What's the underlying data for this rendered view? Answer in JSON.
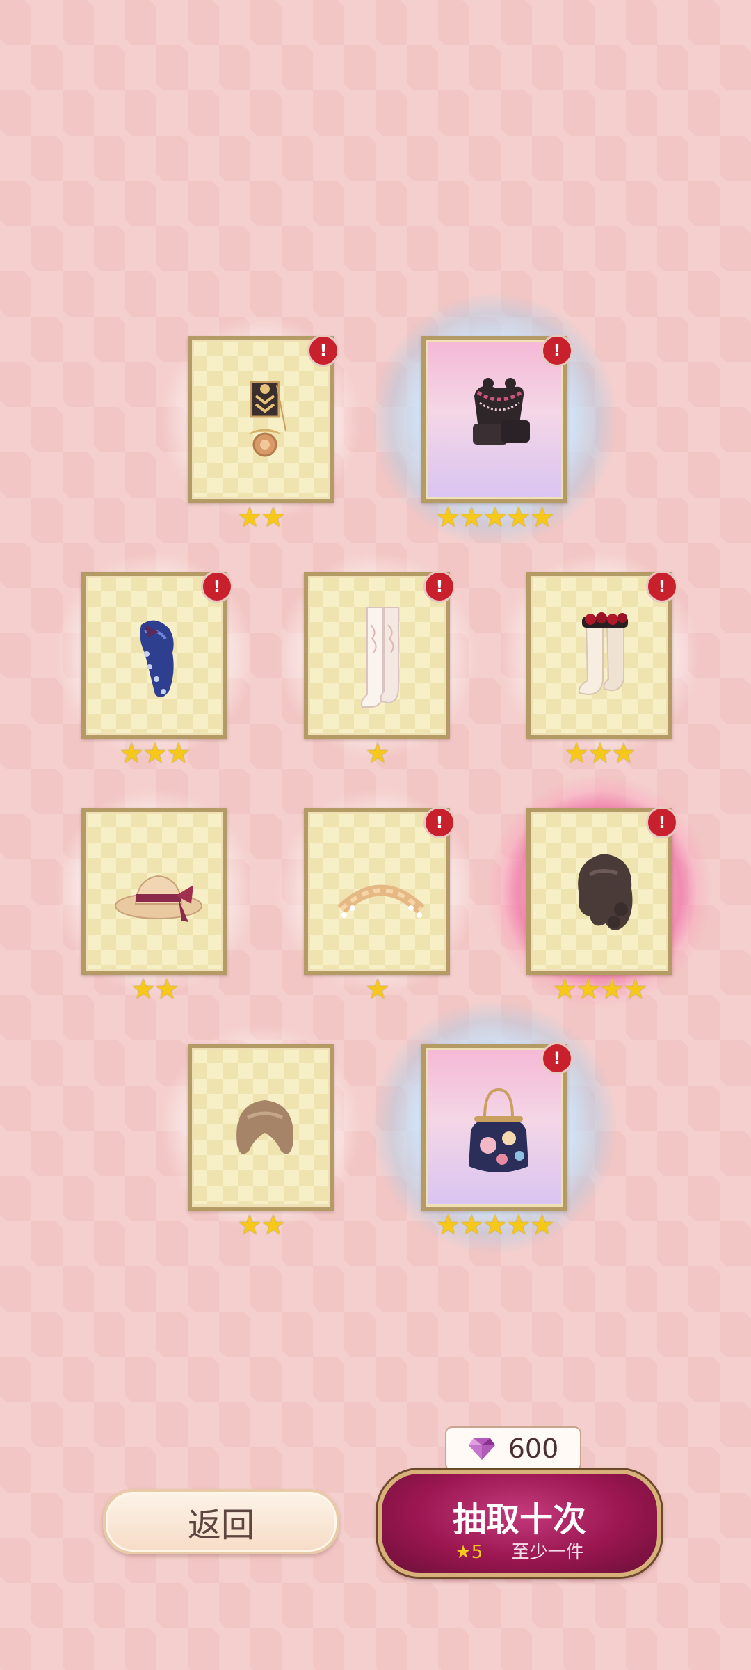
{
  "badge_text": "!",
  "items": [
    {
      "name": "medal-brooch",
      "stars": "★★",
      "rarity": 2,
      "badge": true
    },
    {
      "name": "black-platform-shoes",
      "stars": "★★★★★",
      "rarity": 5,
      "badge": true
    },
    {
      "name": "blue-lace-hair-ornament",
      "stars": "★★★",
      "rarity": 3,
      "badge": true
    },
    {
      "name": "white-lace-stockings",
      "stars": "★",
      "rarity": 1,
      "badge": true
    },
    {
      "name": "rose-frill-socks",
      "stars": "★★★",
      "rarity": 3,
      "badge": true
    },
    {
      "name": "straw-hat-plaid-bow",
      "stars": "★★",
      "rarity": 2,
      "badge": false
    },
    {
      "name": "braided-pearl-headband",
      "stars": "★",
      "rarity": 1,
      "badge": true
    },
    {
      "name": "dark-curly-wig",
      "stars": "★★★★",
      "rarity": 4,
      "badge": true
    },
    {
      "name": "brown-bob-wig",
      "stars": "★★",
      "rarity": 2,
      "badge": false
    },
    {
      "name": "floral-clasp-handbag",
      "stars": "★★★★★",
      "rarity": 5,
      "badge": true
    }
  ],
  "back_button": {
    "label": "返回"
  },
  "cost": {
    "amount": "600",
    "icon": "diamond-icon"
  },
  "draw_button": {
    "label": "抽取十次",
    "sub_star": "★5",
    "sub_text": "至少一件"
  }
}
